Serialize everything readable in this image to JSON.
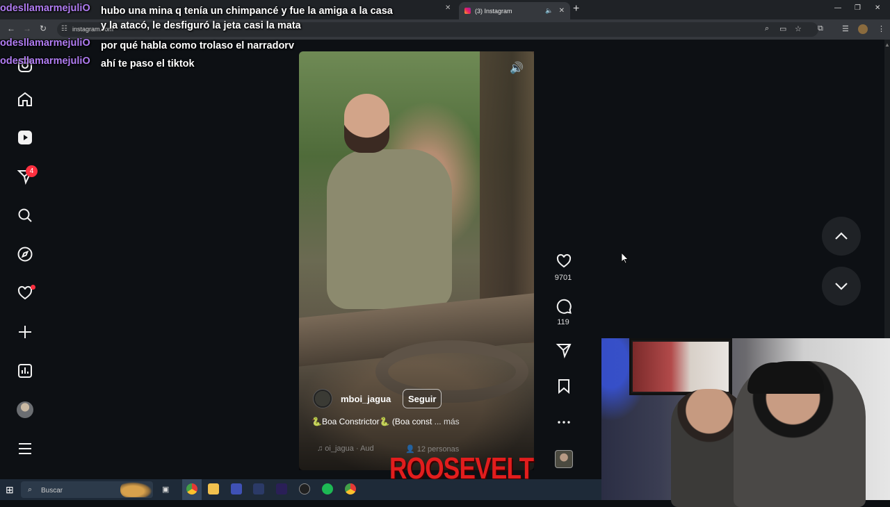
{
  "browser": {
    "active_tab_title": "(3) Instagram",
    "url": "instagram.com"
  },
  "chat": [
    {
      "user": "odesllamarmejuliO",
      "message": "hubo una mina q tenía un chimpancé y fue la amiga a la casa"
    },
    {
      "user": "",
      "message": "y la atacó, le desfiguró la jeta casi la mata"
    },
    {
      "user": "odesllamarmejuliO",
      "message": "por qué habla como trolaso el narradorv"
    },
    {
      "user": "odesllamarmejuliO",
      "message": "ahí te paso el tiktok"
    }
  ],
  "sidebar": {
    "notifications_badge": "4",
    "icons": [
      "instagram-icon",
      "home-icon",
      "reels-icon",
      "messages-icon",
      "search-icon",
      "explore-icon",
      "notifications-icon",
      "create-icon",
      "dashboard-icon",
      "profile-avatar",
      "menu-icon"
    ]
  },
  "reel": {
    "author": "mboi_jagua",
    "follow_label": "Seguir",
    "caption": "🐍Boa Constrictor🐍 (Boa const",
    "caption_more": "... más",
    "audio": "♫  oi_jagua · Aud",
    "people": "👤 12 personas",
    "likes": "9701",
    "comments": "119"
  },
  "watermark": "ROOSEVELT",
  "taskbar": {
    "search_placeholder": "Buscar"
  },
  "colors": {
    "page_bg": "#0d1014",
    "chat_user": "#b07cf2",
    "badge": "#ff3040",
    "watermark": "#e11d1d"
  }
}
